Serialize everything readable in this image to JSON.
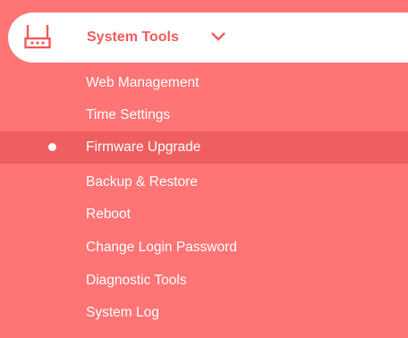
{
  "menu": {
    "header": {
      "label": "System Tools",
      "icon": "router-icon",
      "expand_icon": "chevron-down-icon",
      "header_text_color": "#f05a5a"
    },
    "background_color": "#ff7474",
    "active_item_color": "#ef5f5f",
    "items": [
      {
        "label": "Web Management"
      },
      {
        "label": "Time Settings"
      },
      {
        "label": "Firmware Upgrade",
        "active": true
      },
      {
        "label": "Backup & Restore"
      },
      {
        "label": "Reboot"
      },
      {
        "label": "Change Login Password"
      },
      {
        "label": "Diagnostic Tools"
      },
      {
        "label": "System Log"
      }
    ]
  }
}
